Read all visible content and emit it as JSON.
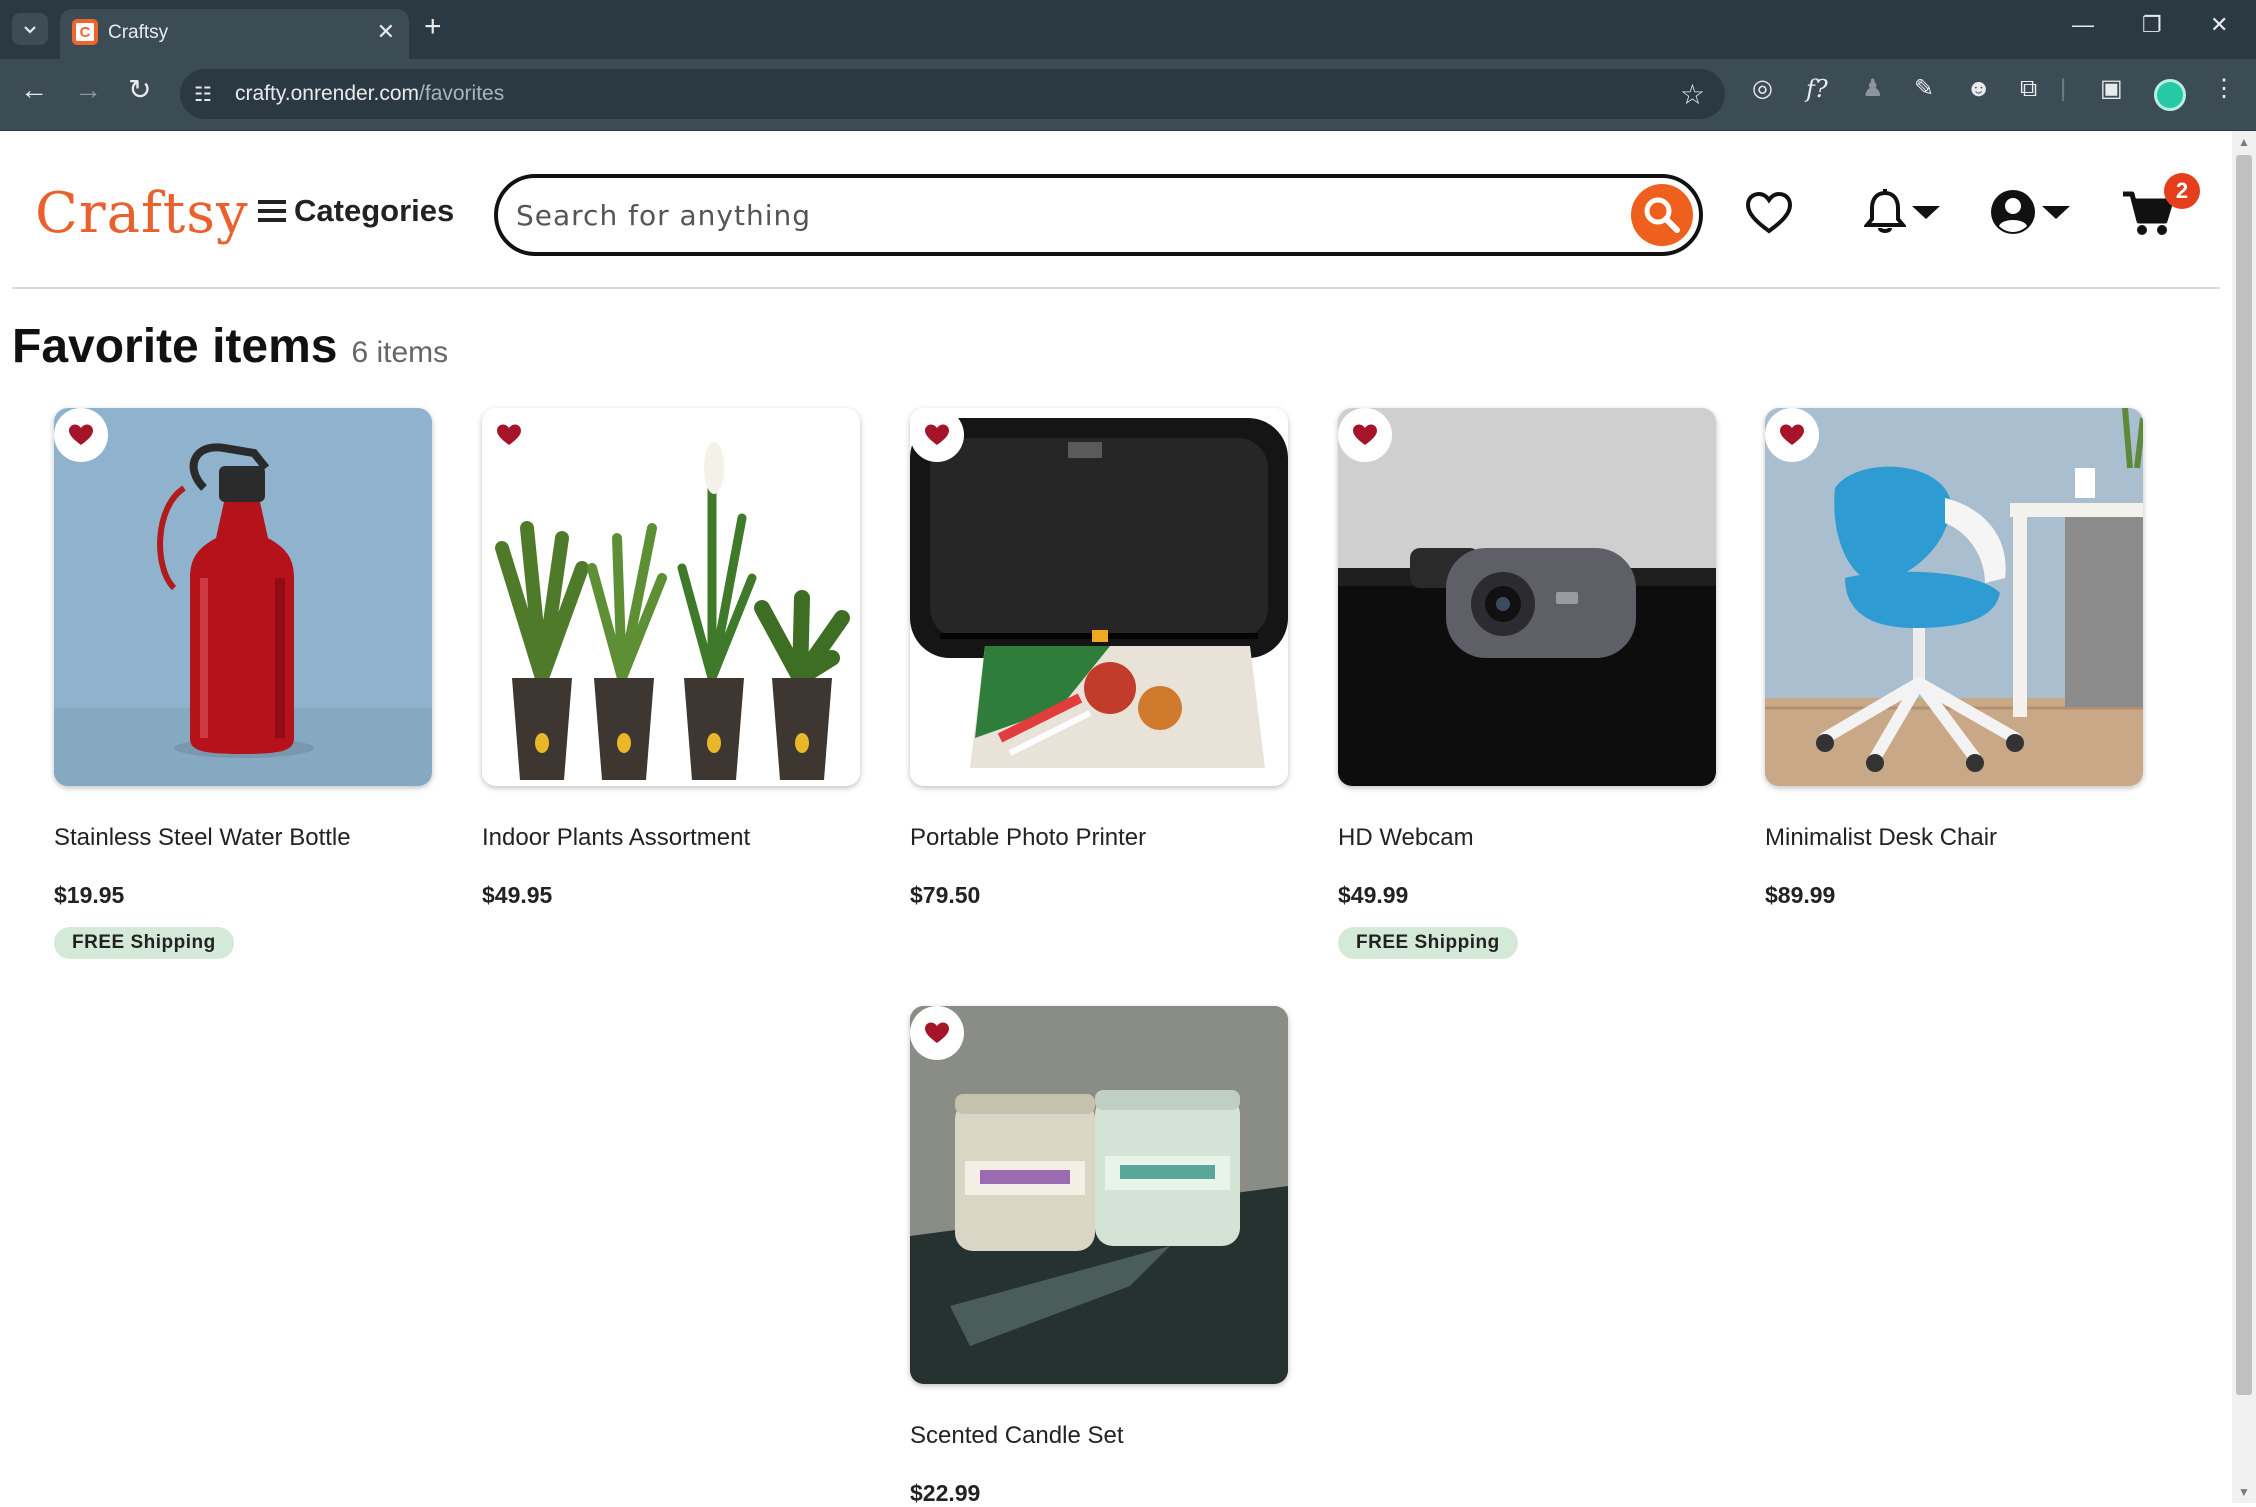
{
  "browser": {
    "tab_title": "Craftsy",
    "url_host": "crafty.onrender.com",
    "url_path": "/favorites",
    "colors": {
      "frame": "#2b3a42",
      "toolbar": "#3c4c55"
    }
  },
  "header": {
    "logo": "Craftsy",
    "categories_label": "Categories",
    "search_placeholder": "Search for anything",
    "cart_count": "2",
    "icons": [
      "heart-icon",
      "bell-icon",
      "user-icon",
      "cart-icon"
    ],
    "accent_color": "#ef5f1e"
  },
  "page": {
    "title": "Favorite items",
    "count_label": "6 items"
  },
  "products": [
    {
      "name": "Stainless Steel Water Bottle",
      "price": "$19.95",
      "shipping": "FREE Shipping"
    },
    {
      "name": "Indoor Plants Assortment",
      "price": "$49.95",
      "shipping": ""
    },
    {
      "name": "Portable Photo Printer",
      "price": "$79.50",
      "shipping": ""
    },
    {
      "name": "HD Webcam",
      "price": "$49.99",
      "shipping": "FREE Shipping"
    },
    {
      "name": "Minimalist Desk Chair",
      "price": "$89.99",
      "shipping": ""
    },
    {
      "name": "Scented Candle Set",
      "price": "$22.99",
      "shipping": ""
    }
  ]
}
